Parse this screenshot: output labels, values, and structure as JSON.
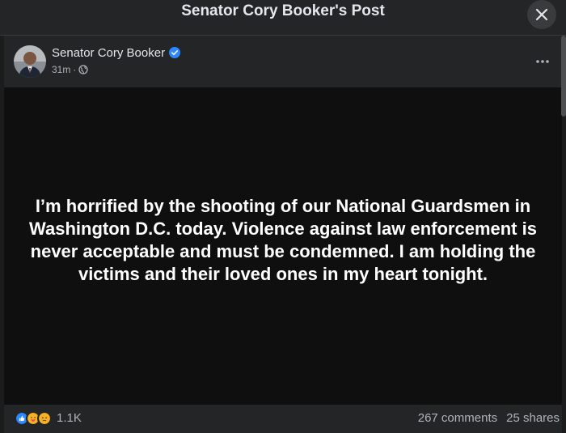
{
  "modal": {
    "title": "Senator Cory Booker's Post"
  },
  "post": {
    "author": "Senator Cory Booker",
    "time": "31m",
    "separator": "·",
    "body": "I’m horrified by the shooting of our National Guardsmen in Washington D.C. today. Violence against law enforcement is never acceptable and must be condemned. I am holding the victims and their loved ones in my heart tonight."
  },
  "footer": {
    "reaction_count": "1.1K",
    "comments": "267 comments",
    "shares": "25 shares"
  },
  "colors": {
    "background": "#1c1c1d",
    "card": "#242526",
    "text_post_bg": "#0f0f10",
    "verified_blue": "#2d88ff",
    "secondary_text": "#b0b3b8"
  },
  "icons": {
    "close": "close-icon",
    "verified": "verified-badge-icon",
    "globe": "globe-icon",
    "more": "more-options-icon",
    "reactions": [
      "like-icon",
      "care-icon",
      "sad-icon"
    ]
  }
}
